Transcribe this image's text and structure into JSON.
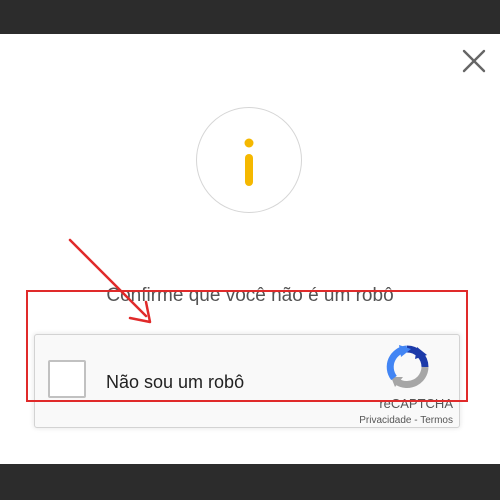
{
  "dialog": {
    "close_icon": "close-icon",
    "info_icon": "info-icon",
    "prompt": "Confirme que você não é um robô"
  },
  "recaptcha": {
    "checkbox_label": "Não sou um robô",
    "brand": "reCAPTCHA",
    "privacy": "Privacidade",
    "separator": " - ",
    "terms": "Termos",
    "logo_icon": "recaptcha-logo-icon"
  },
  "annotation": {
    "arrow_icon": "red-arrow-icon",
    "highlight_color": "#e02a2a"
  },
  "colors": {
    "backdrop": "#2c2c2c",
    "info_accent": "#f5b800",
    "text": "#545454"
  }
}
